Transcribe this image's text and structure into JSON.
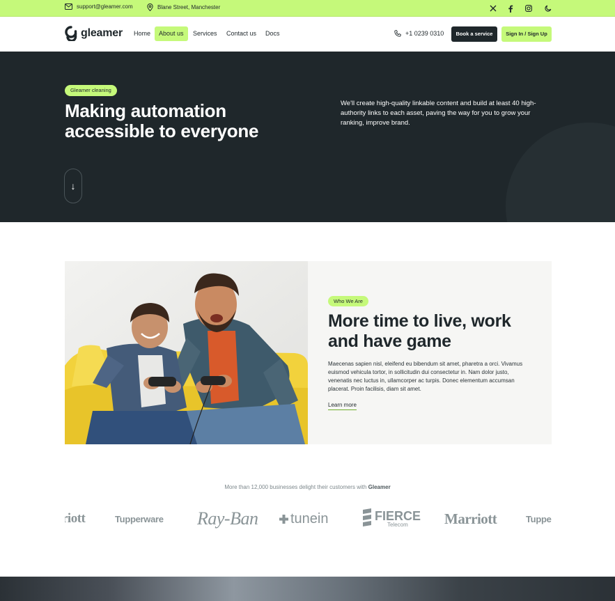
{
  "colors": {
    "accent": "#c5f97a",
    "dark": "#1f272b",
    "muted": "#8a9497"
  },
  "topbar": {
    "email": "support@gleamer.com",
    "address": "Blane Street, Manchester",
    "icons": [
      "mail-icon",
      "map-pin-icon",
      "x-twitter-icon",
      "facebook-icon",
      "instagram-icon",
      "moon-icon"
    ]
  },
  "header": {
    "brand": "gleamer",
    "nav": [
      {
        "label": "Home",
        "active": false
      },
      {
        "label": "About us",
        "active": true
      },
      {
        "label": "Services",
        "active": false
      },
      {
        "label": "Contact us",
        "active": false
      },
      {
        "label": "Docs",
        "active": false
      }
    ],
    "phone": "+1 0239 0310",
    "book_label": "Book a service",
    "sign_label": "Sign In / Sign Up"
  },
  "hero": {
    "badge": "Gleamer cleaning",
    "title_line1": "Making automation",
    "title_line2": "accessible to everyone",
    "text": "We'll create high-quality linkable content and build at least 40 high-authority links to each asset, paving the way for you to grow your ranking, improve brand.",
    "scroll_icon": "↓"
  },
  "about": {
    "badge": "Who We Are",
    "title_line1": "More time to live, work",
    "title_line2": "and have game",
    "text": "Maecenas sapien nisl, eleifend eu bibendum sit amet, pharetra a orci. Vivamus euismod vehicula tortor, in sollicitudin dui consectetur in. Nam dolor justo, venenatis nec luctus in, ullamcorper ac turpis. Donec elementum accumsan placerat. Proin facilisis, diam sit amet.",
    "link": "Learn more"
  },
  "clients": {
    "note_prefix": "More than 12,000 businesses delight their customers with",
    "note_brand": "Gleamer",
    "logos": [
      "riott",
      "Tupperware",
      "Ray-Ban",
      "tunein",
      "FIERCE",
      "Telecom",
      "Marriott",
      "Tuppe"
    ]
  }
}
